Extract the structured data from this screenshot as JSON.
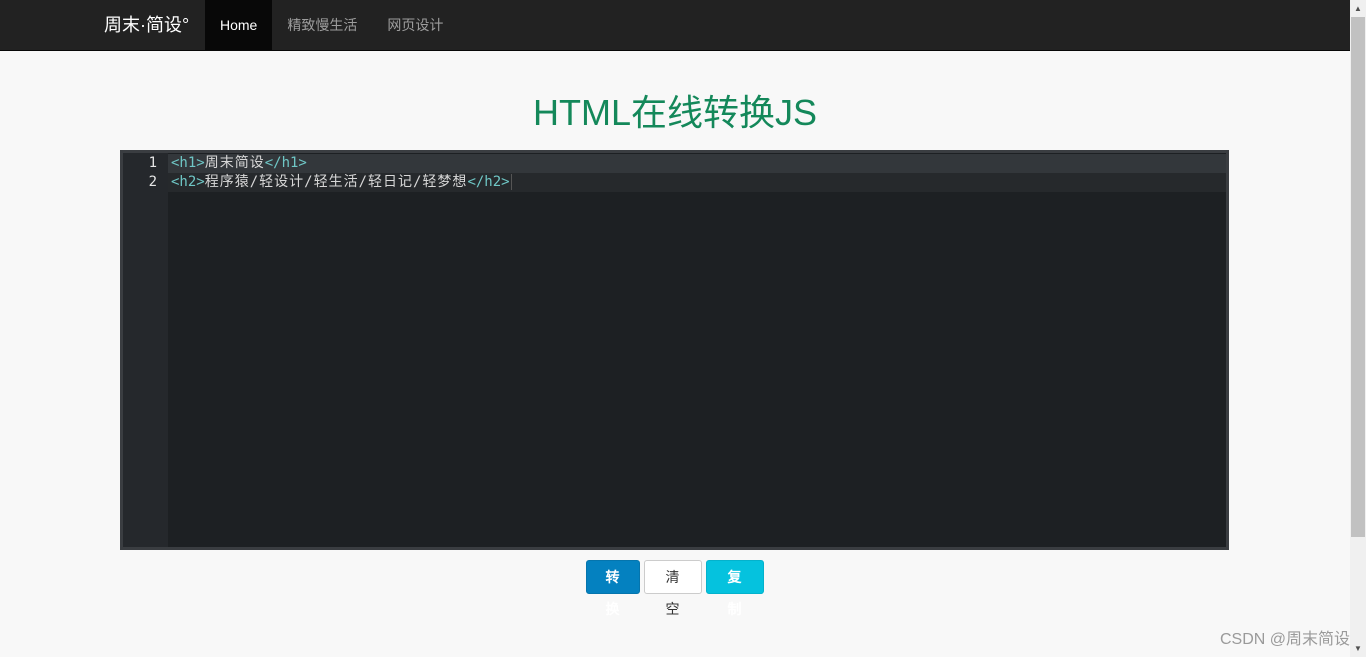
{
  "navbar": {
    "brand": "周末·简设°",
    "items": [
      {
        "label": "Home",
        "active": true
      },
      {
        "label": "精致慢生活",
        "active": false
      },
      {
        "label": "网页设计",
        "active": false
      }
    ]
  },
  "main": {
    "title": "HTML在线转换JS"
  },
  "editor": {
    "lines": [
      {
        "number": "1",
        "open_tag": "<h1>",
        "text": "周末简设",
        "close_tag": "</h1>"
      },
      {
        "number": "2",
        "open_tag": "<h2>",
        "text": "程序猿/轻设计/轻生活/轻日记/轻梦想",
        "close_tag": "</h2>"
      }
    ]
  },
  "actions": {
    "convert_label": "转换",
    "clear_label": "清 空",
    "copy_label": "复 制"
  },
  "watermark": "CSDN @周末简设",
  "colors": {
    "title": "#14885a",
    "navbar_bg": "#222222",
    "editor_bg": "#1d2023",
    "tag_color": "#6fc7c6",
    "primary": "#0481c0",
    "info": "#05c2de"
  },
  "scrollbar": {
    "up_icon": "▲",
    "down_icon": "▼"
  }
}
